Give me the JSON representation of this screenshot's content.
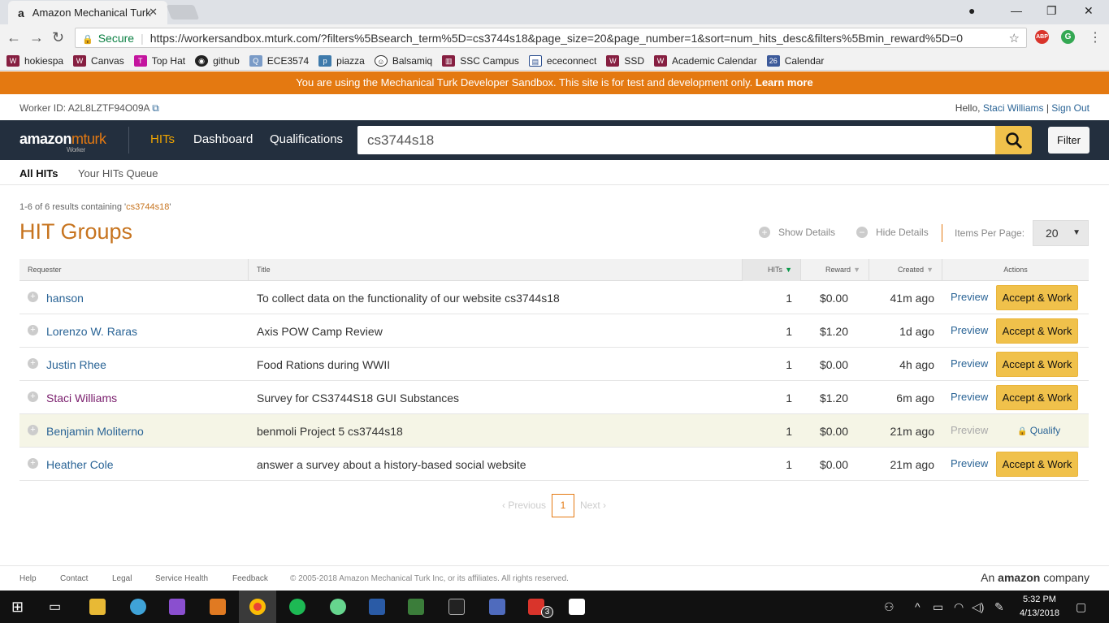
{
  "browser": {
    "tab_title": "Amazon Mechanical Turk",
    "secure_label": "Secure",
    "url": "https://workersandbox.mturk.com/?filters%5Bsearch_term%5D=cs3744s18&page_size=20&page_number=1&sort=num_hits_desc&filters%5Bmin_reward%5D=0",
    "ext_abp": "ABP",
    "bookmarks": [
      "hokiespa",
      "Canvas",
      "Top Hat",
      "github",
      "ECE3574",
      "piazza",
      "Balsamiq",
      "SSC Campus",
      "ececonnect",
      "SSD",
      "Academic Calendar",
      "Calendar"
    ],
    "calendar_icon_text": "26"
  },
  "banner": {
    "text": "You are using the Mechanical Turk Developer Sandbox. This site is for test and development only.",
    "link": "Learn more"
  },
  "worker": {
    "id_label": "Worker ID: A2L8LZTF94O09A",
    "hello": "Hello,",
    "name": "Staci Williams",
    "signout": "Sign Out"
  },
  "nav": {
    "logo_main": "amazon",
    "logo_sub": "mturk",
    "logo_small": "Worker",
    "links": [
      "HITs",
      "Dashboard",
      "Qualifications"
    ],
    "search_value": "cs3744s18",
    "filter": "Filter"
  },
  "subnav": [
    "All HITs",
    "Your HITs Queue"
  ],
  "results": {
    "prefix": "1-6 of 6 results containing '",
    "term": "cs3744s18",
    "suffix": "'"
  },
  "page_title": "HIT Groups",
  "controls": {
    "show": "Show Details",
    "hide": "Hide Details",
    "ipp_label": "Items Per Page:",
    "ipp_value": "20"
  },
  "table": {
    "headers": [
      "Requester",
      "Title",
      "HITs",
      "Reward",
      "Created",
      "Actions"
    ],
    "rows": [
      {
        "requester": "hanson",
        "title": "To collect data on the functionality of our website cs3744s18",
        "hits": "1",
        "reward": "$0.00",
        "created": "41m ago",
        "preview": "Preview",
        "action": "Accept & Work"
      },
      {
        "requester": "Lorenzo W. Raras",
        "title": "Axis POW Camp Review",
        "hits": "1",
        "reward": "$1.20",
        "created": "1d ago",
        "preview": "Preview",
        "action": "Accept & Work"
      },
      {
        "requester": "Justin Rhee",
        "title": "Food Rations during WWII",
        "hits": "1",
        "reward": "$0.00",
        "created": "4h ago",
        "preview": "Preview",
        "action": "Accept & Work"
      },
      {
        "requester": "Staci Williams",
        "title": "Survey for CS3744S18 GUI Substances",
        "hits": "1",
        "reward": "$1.20",
        "created": "6m ago",
        "preview": "Preview",
        "action": "Accept & Work"
      },
      {
        "requester": "Benjamin Moliterno",
        "title": "benmoli Project 5 cs3744s18",
        "hits": "1",
        "reward": "$0.00",
        "created": "21m ago",
        "preview": "Preview",
        "action": "Qualify"
      },
      {
        "requester": "Heather Cole",
        "title": "answer a survey about a history-based social website",
        "hits": "1",
        "reward": "$0.00",
        "created": "21m ago",
        "preview": "Preview",
        "action": "Accept & Work"
      }
    ]
  },
  "pager": {
    "prev": "‹ Previous",
    "current": "1",
    "next": "Next ›"
  },
  "footer": {
    "links": [
      "Help",
      "Contact",
      "Legal",
      "Service Health",
      "Feedback"
    ],
    "copyright": "© 2005-2018 Amazon Mechanical Turk Inc, or its affiliates. All rights reserved.",
    "amazon_a": "An",
    "amazon_b": "amazon",
    "amazon_c": "company"
  },
  "taskbar": {
    "time": "5:32 PM",
    "date": "4/13/2018",
    "badge": "3"
  }
}
